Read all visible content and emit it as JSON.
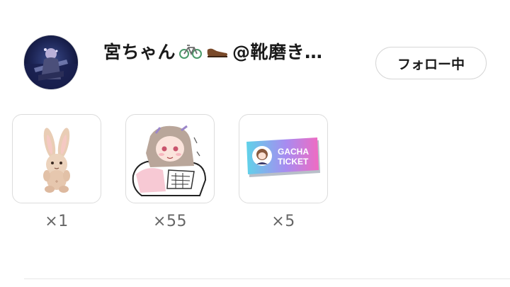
{
  "user": {
    "display_name": "宮ちゃん",
    "name_suffix": "@靴磨き…",
    "name_emojis": [
      "bicycle-icon",
      "shoe-icon"
    ],
    "follow_label": "フォロー中"
  },
  "gifts": [
    {
      "icon": "plush-rabbit-icon",
      "count": "×1"
    },
    {
      "icon": "anime-girl-sticker-icon",
      "count": "×55"
    },
    {
      "icon": "gacha-ticket-icon",
      "count": "×5",
      "ticket_text": [
        "GACHA",
        "TICKET"
      ]
    }
  ],
  "colors": {
    "accent_text": "#1a1a1a",
    "muted_text": "#666666",
    "border": "#dcdcdc"
  }
}
